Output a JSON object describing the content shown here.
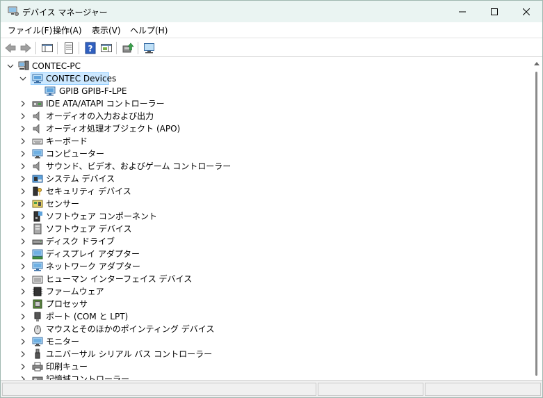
{
  "window": {
    "title": "デバイス マネージャー"
  },
  "menu": [
    "ファイル(F)",
    "操作(A)",
    "表示(V)",
    "ヘルプ(H)"
  ],
  "toolbar": {
    "buttons": [
      "back-icon",
      "forward-icon",
      "show-hide-console-tree-icon",
      "properties-icon",
      "help-icon",
      "action-pane-icon",
      "update-driver-icon",
      "scan-hardware-icon"
    ]
  },
  "tree": {
    "root": "CONTEC-PC",
    "selected": "CONTEC Devices",
    "contec_child": "GPIB GPIB-F-LPE",
    "categories": [
      "IDE ATA/ATAPI コントローラー",
      "オーディオの入力および出力",
      "オーディオ処理オブジェクト (APO)",
      "キーボード",
      "コンピューター",
      "サウンド、ビデオ、およびゲーム コントローラー",
      "システム デバイス",
      "セキュリティ デバイス",
      "センサー",
      "ソフトウェア コンポーネント",
      "ソフトウェア デバイス",
      "ディスク ドライブ",
      "ディスプレイ アダプター",
      "ネットワーク アダプター",
      "ヒューマン インターフェイス デバイス",
      "ファームウェア",
      "プロセッサ",
      "ポート (COM と LPT)",
      "マウスとそのほかのポインティング デバイス",
      "モニター",
      "ユニバーサル シリアル バス コントローラー",
      "印刷キュー",
      "記憶域コントローラー"
    ]
  },
  "colors": {
    "titlebar_bg": "#eaf4f2",
    "selection_bg": "#cce8ff",
    "selection_border": "#99d1ff"
  }
}
